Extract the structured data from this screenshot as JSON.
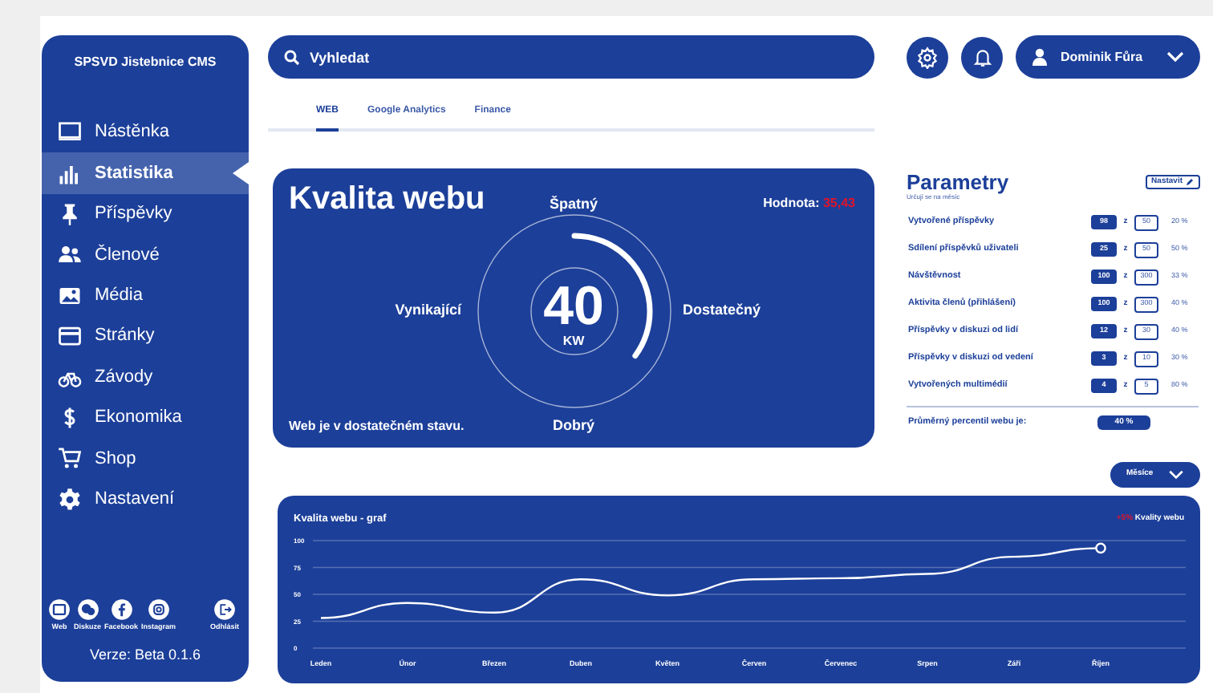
{
  "sidebar": {
    "title": "SPSVD Jistebnice CMS",
    "items": [
      {
        "label": "Nástěnka",
        "selected": false
      },
      {
        "label": "Statistika",
        "selected": true
      },
      {
        "label": "Příspěvky",
        "selected": false
      },
      {
        "label": "Členové",
        "selected": false
      },
      {
        "label": "Média",
        "selected": false
      },
      {
        "label": "Stránky",
        "selected": false
      },
      {
        "label": "Závody",
        "selected": false
      },
      {
        "label": "Ekonomika",
        "selected": false
      },
      {
        "label": "Shop",
        "selected": false
      },
      {
        "label": "Nastavení",
        "selected": false
      }
    ],
    "links": [
      {
        "label": "Web"
      },
      {
        "label": "Diskuze"
      },
      {
        "label": "Facebook"
      },
      {
        "label": "Instagram"
      }
    ],
    "logout": "Odhlásit",
    "version": "Verze: Beta 0.1.6"
  },
  "search": {
    "placeholder": "Vyhledat"
  },
  "user": {
    "name": "Dominik Fůra"
  },
  "tabs": [
    {
      "label": "WEB",
      "selected": true
    },
    {
      "label": "Google Analytics",
      "selected": false
    },
    {
      "label": "Finance",
      "selected": false
    }
  ],
  "quality": {
    "title": "Kvalita webu",
    "value_label": "Hodnota:",
    "value": "35,43",
    "top": "Špatný",
    "left": "Vynikající",
    "right": "Dostatečný",
    "bottom": "Dobrý",
    "score": "40",
    "unit": "KW",
    "level": 0.35,
    "status": "Web je v dostatečném stavu."
  },
  "parameters": {
    "title": "Parametry",
    "subtitle": "Určují se na měsíc",
    "edit_button": "Nastavit",
    "rows": [
      {
        "label": "Vytvořené příspěvky",
        "value": "98",
        "of": "z",
        "max": "50",
        "percent": "20 %"
      },
      {
        "label": "Sdílení příspěvků uživateli",
        "value": "25",
        "of": "z",
        "max": "50",
        "percent": "50 %"
      },
      {
        "label": "Návštěvnost",
        "value": "100",
        "of": "z",
        "max": "300",
        "percent": "33 %"
      },
      {
        "label": "Aktivita členů (přihlášení)",
        "value": "100",
        "of": "z",
        "max": "300",
        "percent": "40 %"
      },
      {
        "label": "Příspěvky v diskuzi od lidí",
        "value": "12",
        "of": "z",
        "max": "30",
        "percent": "40 %"
      },
      {
        "label": "Příspěvky v diskuzi od vedení",
        "value": "3",
        "of": "z",
        "max": "10",
        "percent": "30 %"
      },
      {
        "label": "Vytvořených multimédií",
        "value": "4",
        "of": "z",
        "max": "5",
        "percent": "80 %"
      }
    ],
    "average_label": "Průměrný percentil webu je:",
    "average": "40 %"
  },
  "period": {
    "label": "Měsíce"
  },
  "chart": {
    "legend_change": "+5%",
    "chart_data": {
      "type": "line",
      "title": "Kvalita webu - graf",
      "categories": [
        "Leden",
        "Únor",
        "Březen",
        "Duben",
        "Květen",
        "Červen",
        "Červenec",
        "Srpen",
        "Září",
        "Říjen"
      ],
      "series": [
        {
          "name": "Kvality webu",
          "color": "#ffffff",
          "values": [
            28,
            42,
            33,
            64,
            49,
            64,
            65,
            69,
            85,
            93
          ]
        }
      ],
      "ylim": [
        0,
        100
      ],
      "yticks": [
        0,
        25,
        50,
        75,
        100
      ],
      "grid": true
    }
  }
}
